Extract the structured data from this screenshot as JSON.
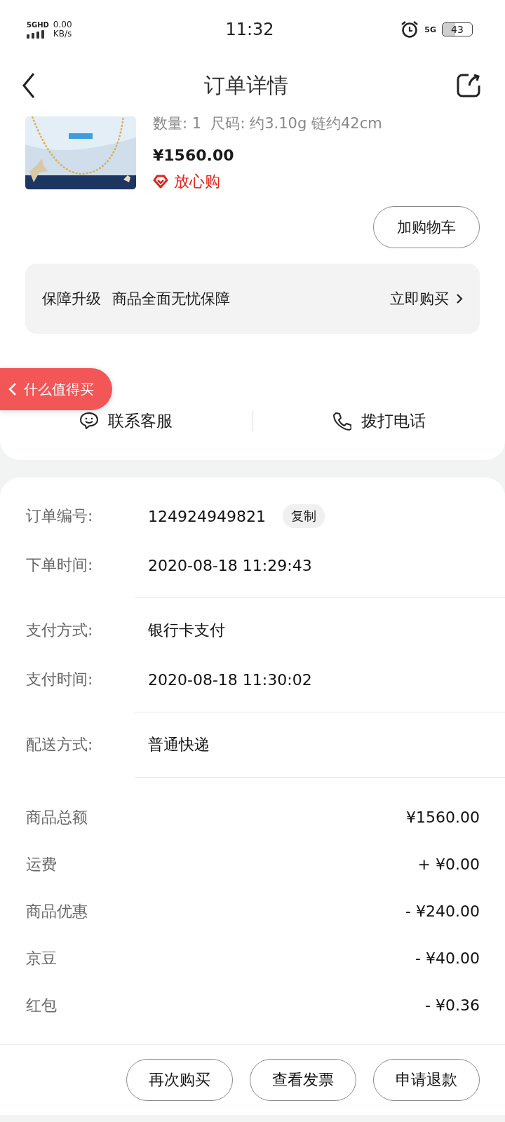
{
  "status_bar": {
    "network": "5GHD",
    "speed": "0.00",
    "speed_unit": "KB/s",
    "time": "11:32",
    "network_type": "5G",
    "battery": "43"
  },
  "header": {
    "title": "订单详情"
  },
  "product": {
    "spec": "数量: 1  尺码: 约3.10g 链约42cm",
    "price": "¥1560.00",
    "guarantee": "放心购",
    "button": "加购物车"
  },
  "protection": {
    "title": "保障升级",
    "subtitle": "商品全面无忧保障",
    "action": "立即购买"
  },
  "floating_tab": {
    "label": "什么值得买"
  },
  "contact": [
    {
      "kind": "chat",
      "label": "联系客服"
    },
    {
      "kind": "phone",
      "label": "拨打电话"
    }
  ],
  "order_info": [
    {
      "label": "订单编号:",
      "value": "124924949821",
      "copy": "复制",
      "divider_after": false
    },
    {
      "label": "下单时间:",
      "value": "2020-08-18 11:29:43",
      "divider_after": true
    },
    {
      "label": "支付方式:",
      "value": "银行卡支付",
      "divider_after": false
    },
    {
      "label": "支付时间:",
      "value": "2020-08-18 11:30:02",
      "divider_after": true
    },
    {
      "label": "配送方式:",
      "value": "普通快递",
      "divider_after": true
    }
  ],
  "totals": [
    {
      "label": "商品总额",
      "value": "¥1560.00"
    },
    {
      "label": "运费",
      "value": "+ ¥0.00"
    },
    {
      "label": "商品优惠",
      "value": "- ¥240.00"
    },
    {
      "label": "京豆",
      "value": "- ¥40.00"
    },
    {
      "label": "红包",
      "value": "- ¥0.36"
    }
  ],
  "actions": [
    "再次购买",
    "查看发票",
    "申请退款"
  ]
}
